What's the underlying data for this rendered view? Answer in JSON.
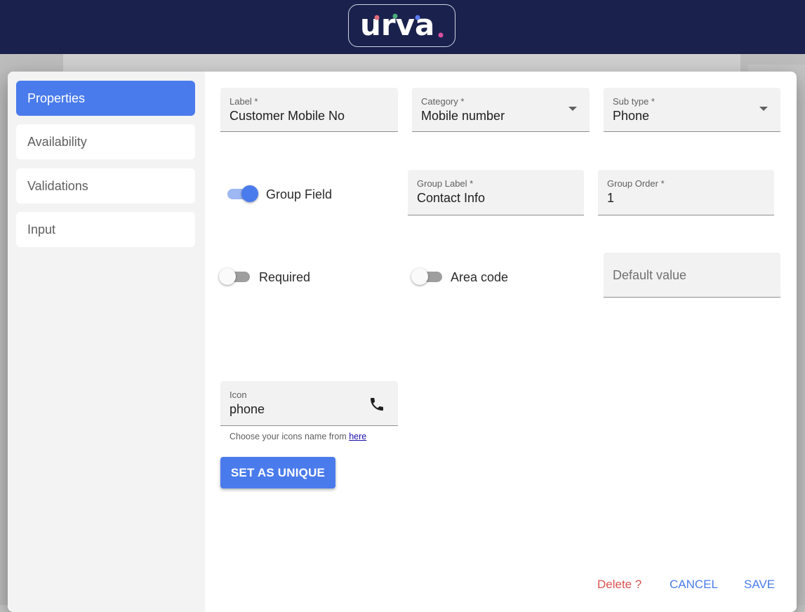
{
  "header": {
    "logo_text": "urva"
  },
  "sidebar": {
    "items": [
      {
        "label": "Properties",
        "active": true
      },
      {
        "label": "Availability",
        "active": false
      },
      {
        "label": "Validations",
        "active": false
      },
      {
        "label": "Input",
        "active": false
      }
    ]
  },
  "form": {
    "label_field": {
      "label": "Label *",
      "value": "Customer Mobile No"
    },
    "category_field": {
      "label": "Category *",
      "value": "Mobile number"
    },
    "subtype_field": {
      "label": "Sub type *",
      "value": "Phone"
    },
    "group_field_toggle": {
      "label": "Group Field",
      "on": true
    },
    "group_label_field": {
      "label": "Group Label *",
      "value": "Contact Info"
    },
    "group_order_field": {
      "label": "Group Order *",
      "value": "1"
    },
    "required_toggle": {
      "label": "Required",
      "on": false
    },
    "area_code_toggle": {
      "label": "Area code",
      "on": false
    },
    "default_value_field": {
      "placeholder": "Default value"
    },
    "icon_field": {
      "label": "Icon",
      "value": "phone",
      "icon": "phone-icon"
    },
    "icon_helper": {
      "text": "Choose your icons name from ",
      "link_text": "here"
    },
    "unique_button": "SET AS UNIQUE"
  },
  "actions": {
    "delete": "Delete ?",
    "cancel": "CANCEL",
    "save": "SAVE"
  },
  "colors": {
    "accent": "#4a7bec",
    "header_bg": "#1a214d",
    "danger": "#d9534f"
  }
}
